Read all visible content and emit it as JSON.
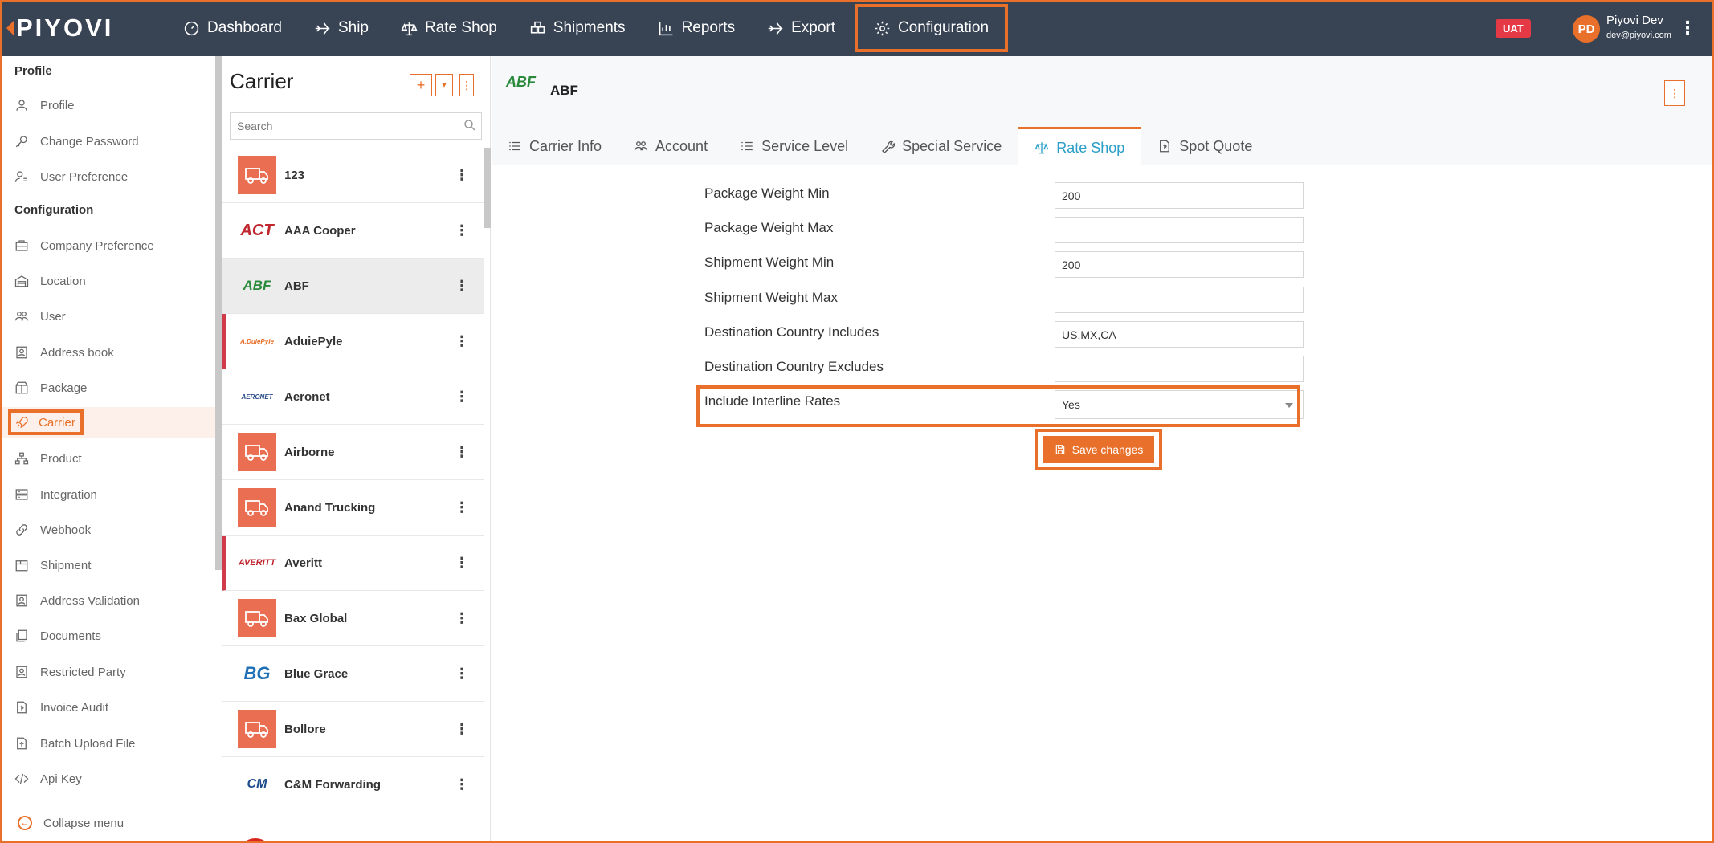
{
  "brand": {
    "logo_text": "PIYOVI"
  },
  "nav": [
    {
      "label": "Dashboard",
      "icon": "dashboard-icon"
    },
    {
      "label": "Ship",
      "icon": "plane-icon"
    },
    {
      "label": "Rate Shop",
      "icon": "scale-icon"
    },
    {
      "label": "Shipments",
      "icon": "boxes-icon"
    },
    {
      "label": "Reports",
      "icon": "chart-icon"
    },
    {
      "label": "Export",
      "icon": "plane-icon"
    },
    {
      "label": "Configuration",
      "icon": "gear-icon"
    }
  ],
  "env_badge": "UAT",
  "user": {
    "initials": "PD",
    "name": "Piyovi Dev",
    "email": "dev@piyovi.com"
  },
  "sidebar": {
    "profile_heading": "Profile",
    "profile_items": [
      "Profile",
      "Change Password",
      "User Preference"
    ],
    "config_heading": "Configuration",
    "config_items": [
      "Company Preference",
      "Location",
      "User",
      "Address book",
      "Package",
      "Carrier",
      "Product",
      "Integration",
      "Webhook",
      "Shipment",
      "Address Validation",
      "Documents",
      "Restricted Party",
      "Invoice Audit",
      "Batch Upload File",
      "Api Key"
    ],
    "active_item": "Carrier",
    "collapse_label": "Collapse menu"
  },
  "carrier_panel": {
    "title": "Carrier",
    "add_button": "+",
    "search_placeholder": "Search",
    "carriers": [
      {
        "name": "123",
        "logo": "truck"
      },
      {
        "name": "AAA Cooper",
        "logo": "ACT"
      },
      {
        "name": "ABF",
        "logo": "ABF",
        "active": true
      },
      {
        "name": "AduiePyle",
        "logo": "A.DuiePyle",
        "flag": true
      },
      {
        "name": "Aeronet",
        "logo": "AERONET"
      },
      {
        "name": "Airborne",
        "logo": "truck"
      },
      {
        "name": "Anand Trucking",
        "logo": "truck"
      },
      {
        "name": "Averitt",
        "logo": "AVERITT",
        "flag": true
      },
      {
        "name": "Bax Global",
        "logo": "truck"
      },
      {
        "name": "Blue Grace",
        "logo": "BG"
      },
      {
        "name": "Bollore",
        "logo": "truck"
      },
      {
        "name": "C&M Forwarding",
        "logo": "CM"
      }
    ]
  },
  "detail": {
    "title": "ABF",
    "logo_text": "ABF",
    "tabs": [
      {
        "label": "Carrier Info",
        "icon": "list-icon"
      },
      {
        "label": "Account",
        "icon": "users-icon"
      },
      {
        "label": "Service Level",
        "icon": "list-icon"
      },
      {
        "label": "Special Service",
        "icon": "wrench-icon"
      },
      {
        "label": "Rate Shop",
        "icon": "scale-icon",
        "active": true
      },
      {
        "label": "Spot Quote",
        "icon": "file-icon"
      }
    ],
    "fields": [
      {
        "label": "Package Weight Min",
        "value": "200"
      },
      {
        "label": "Package Weight Max",
        "value": ""
      },
      {
        "label": "Shipment Weight Min",
        "value": "200"
      },
      {
        "label": "Shipment Weight Max",
        "value": ""
      },
      {
        "label": "Destination Country Includes",
        "value": "US,MX,CA"
      },
      {
        "label": "Destination Country Excludes",
        "value": ""
      },
      {
        "label": "Include Interline Rates",
        "value": "Yes",
        "type": "select"
      }
    ],
    "save_label": "Save changes"
  },
  "colors": {
    "topbar": "#384354",
    "accent": "#e8702a",
    "active_tab_text": "#2a9ec7",
    "truck_logo": "#ea6f52"
  }
}
